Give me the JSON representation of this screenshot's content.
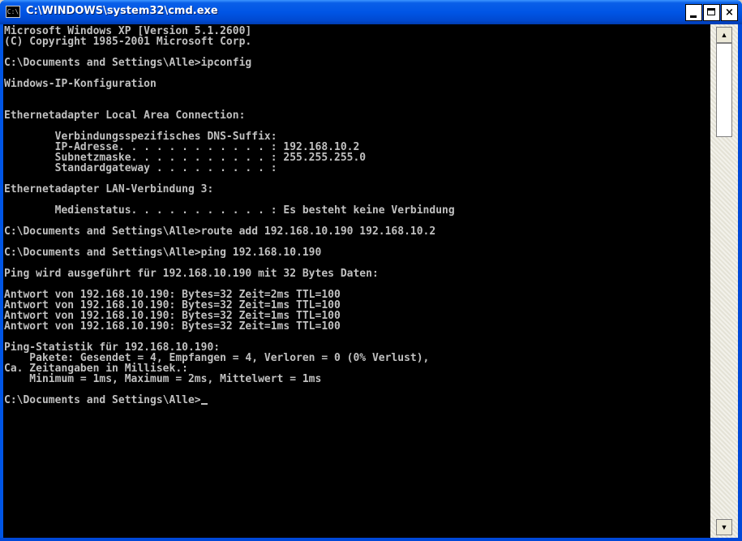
{
  "window": {
    "title": "C:\\WINDOWS\\system32\\cmd.exe",
    "icon_label": "C:\\",
    "icon_name": "cmd-app-icon",
    "buttons": {
      "minimize": "minimize-icon",
      "maximize": "maximize-icon",
      "close_glyph": "×"
    },
    "colors": {
      "title_bar": "#0055e5",
      "console_bg": "#000000",
      "console_fg": "#c0c0c0"
    }
  },
  "console": {
    "lines": [
      "Microsoft Windows XP [Version 5.1.2600]",
      "(C) Copyright 1985-2001 Microsoft Corp.",
      "",
      "C:\\Documents and Settings\\Alle>ipconfig",
      "",
      "Windows-IP-Konfiguration",
      "",
      "",
      "Ethernetadapter Local Area Connection:",
      "",
      "        Verbindungsspezifisches DNS-Suffix:",
      "        IP-Adresse. . . . . . . . . . . . : 192.168.10.2",
      "        Subnetzmaske. . . . . . . . . . . : 255.255.255.0",
      "        Standardgateway . . . . . . . . . :",
      "",
      "Ethernetadapter LAN-Verbindung 3:",
      "",
      "        Medienstatus. . . . . . . . . . . : Es besteht keine Verbindung",
      "",
      "C:\\Documents and Settings\\Alle>route add 192.168.10.190 192.168.10.2",
      "",
      "C:\\Documents and Settings\\Alle>ping 192.168.10.190",
      "",
      "Ping wird ausgeführt für 192.168.10.190 mit 32 Bytes Daten:",
      "",
      "Antwort von 192.168.10.190: Bytes=32 Zeit=2ms TTL=100",
      "Antwort von 192.168.10.190: Bytes=32 Zeit=1ms TTL=100",
      "Antwort von 192.168.10.190: Bytes=32 Zeit=1ms TTL=100",
      "Antwort von 192.168.10.190: Bytes=32 Zeit=1ms TTL=100",
      "",
      "Ping-Statistik für 192.168.10.190:",
      "    Pakete: Gesendet = 4, Empfangen = 4, Verloren = 0 (0% Verlust),",
      "Ca. Zeitangaben in Millisek.:",
      "    Minimum = 1ms, Maximum = 2ms, Mittelwert = 1ms",
      "",
      "C:\\Documents and Settings\\Alle>"
    ],
    "cursor": "_"
  },
  "scrollbar": {
    "up_arrow": "▲",
    "down_arrow": "▼"
  }
}
